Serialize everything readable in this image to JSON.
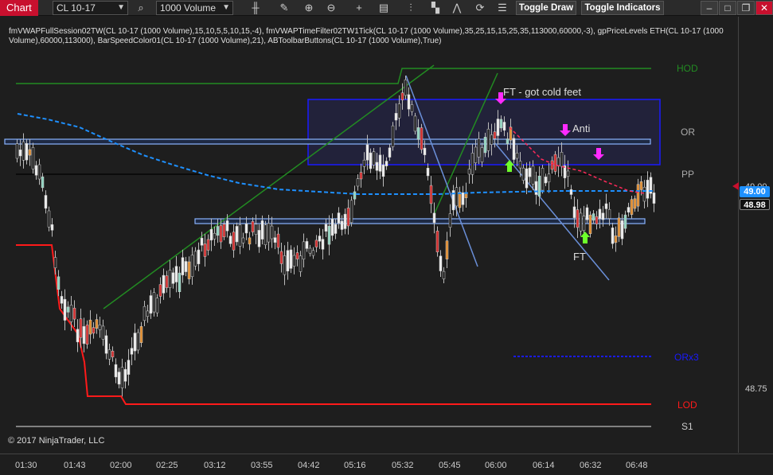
{
  "toolbar": {
    "chart_label": "Chart",
    "instrument": "CL 10-17",
    "interval": "1000 Volume",
    "toggle_draw": "Toggle Draw",
    "toggle_indicators": "Toggle Indicators",
    "icons": [
      "search-icon",
      "bar-style-icon",
      "pencil-icon",
      "zoom-in-icon",
      "zoom-out-icon",
      "crosshair-icon",
      "data-box-icon",
      "indicators-icon",
      "strategies-icon",
      "drawing-tools-icon",
      "refresh-icon",
      "properties-icon"
    ]
  },
  "indicators_text": "fmVWAPFullSession02TW(CL 10-17 (1000 Volume),15,10,5,5,10,15,-4), fmVWAPTimeFilter02TW1Tick(CL 10-17 (1000 Volume),35,25,15,15,25,35,113000,60000,-3), gpPriceLevels ETH(CL 10-17 (1000 Volume),60000,113000), BarSpeedColor01(CL 10-17 (1000 Volume),21), ABToolbarButtons(CL 10-17 (1000 Volume),True)",
  "copyright": "© 2017 NinjaTrader, LLC",
  "level_labels": {
    "hod": "HOD",
    "or": "OR",
    "pp": "PP",
    "orx3": "ORx3",
    "lod": "LOD",
    "s1": "S1"
  },
  "annotations": {
    "ft_cold": "FT - got cold feet",
    "anti": "Anti",
    "ft": "FT"
  },
  "price_axis": {
    "tag_vwap": "49.00",
    "tag_last": "48.98",
    "tick_top": "49.00",
    "tick_bottom": "48.75"
  },
  "time_axis": [
    "01:30",
    "01:43",
    "02:00",
    "02:25",
    "03:12",
    "03:55",
    "04:42",
    "05:16",
    "05:32",
    "05:45",
    "06:00",
    "06:14",
    "06:32",
    "06:48"
  ],
  "colors": {
    "accent": "#c8102e",
    "vwap": "#1e90ff",
    "hod": "#228b22",
    "lod": "#ff1a1a",
    "box": "#1a1aff"
  }
}
